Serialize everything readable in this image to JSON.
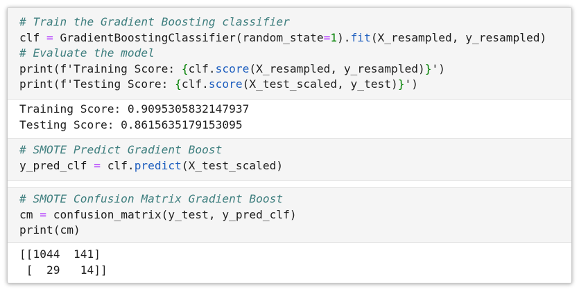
{
  "cells": [
    {
      "kind": "code",
      "lines": [
        [
          {
            "c": "cm",
            "t": "# Train the Gradient Boosting classifier"
          }
        ],
        [
          {
            "c": "",
            "t": "clf "
          },
          {
            "c": "op",
            "t": "="
          },
          {
            "c": "",
            "t": " GradientBoostingClassifier(random_state"
          },
          {
            "c": "op",
            "t": "="
          },
          {
            "c": "num",
            "t": "1"
          },
          {
            "c": "",
            "t": ")."
          },
          {
            "c": "fn",
            "t": "fit"
          },
          {
            "c": "",
            "t": "(X_resampled, y_resampled)"
          }
        ],
        [
          {
            "c": "cm",
            "t": "# Evaluate the model"
          }
        ],
        [
          {
            "c": "",
            "t": "print(f'Training Score: "
          },
          {
            "c": "num",
            "t": "{"
          },
          {
            "c": "",
            "t": "clf."
          },
          {
            "c": "fn",
            "t": "score"
          },
          {
            "c": "",
            "t": "(X_resampled, y_resampled)"
          },
          {
            "c": "num",
            "t": "}"
          },
          {
            "c": "",
            "t": "')"
          }
        ],
        [
          {
            "c": "",
            "t": "print(f'Testing Score: "
          },
          {
            "c": "num",
            "t": "{"
          },
          {
            "c": "",
            "t": "clf."
          },
          {
            "c": "fn",
            "t": "score"
          },
          {
            "c": "",
            "t": "(X_test_scaled, y_test)"
          },
          {
            "c": "num",
            "t": "}"
          },
          {
            "c": "",
            "t": "')"
          }
        ]
      ]
    },
    {
      "kind": "output",
      "lines": [
        [
          {
            "c": "",
            "t": "Training Score: 0.9095305832147937"
          }
        ],
        [
          {
            "c": "",
            "t": "Testing Score: 0.8615635179153095"
          }
        ]
      ]
    },
    {
      "kind": "code",
      "lines": [
        [
          {
            "c": "cm",
            "t": "# SMOTE Predict Gradient Boost"
          }
        ],
        [
          {
            "c": "",
            "t": "y_pred_clf "
          },
          {
            "c": "op",
            "t": "="
          },
          {
            "c": "",
            "t": " clf."
          },
          {
            "c": "fn",
            "t": "predict"
          },
          {
            "c": "",
            "t": "(X_test_scaled)"
          }
        ]
      ]
    },
    {
      "kind": "code",
      "lines": [
        [
          {
            "c": "cm",
            "t": "# SMOTE Confusion Matrix Gradient Boost"
          }
        ],
        [
          {
            "c": "",
            "t": "cm "
          },
          {
            "c": "op",
            "t": "="
          },
          {
            "c": "",
            "t": " confusion_matrix(y_test, y_pred_clf)"
          }
        ],
        [
          {
            "c": "",
            "t": "print(cm)"
          }
        ]
      ]
    },
    {
      "kind": "output",
      "lines": [
        [
          {
            "c": "",
            "t": "[[1044  141]"
          }
        ],
        [
          {
            "c": "",
            "t": " [  29   14]]"
          }
        ]
      ]
    }
  ]
}
